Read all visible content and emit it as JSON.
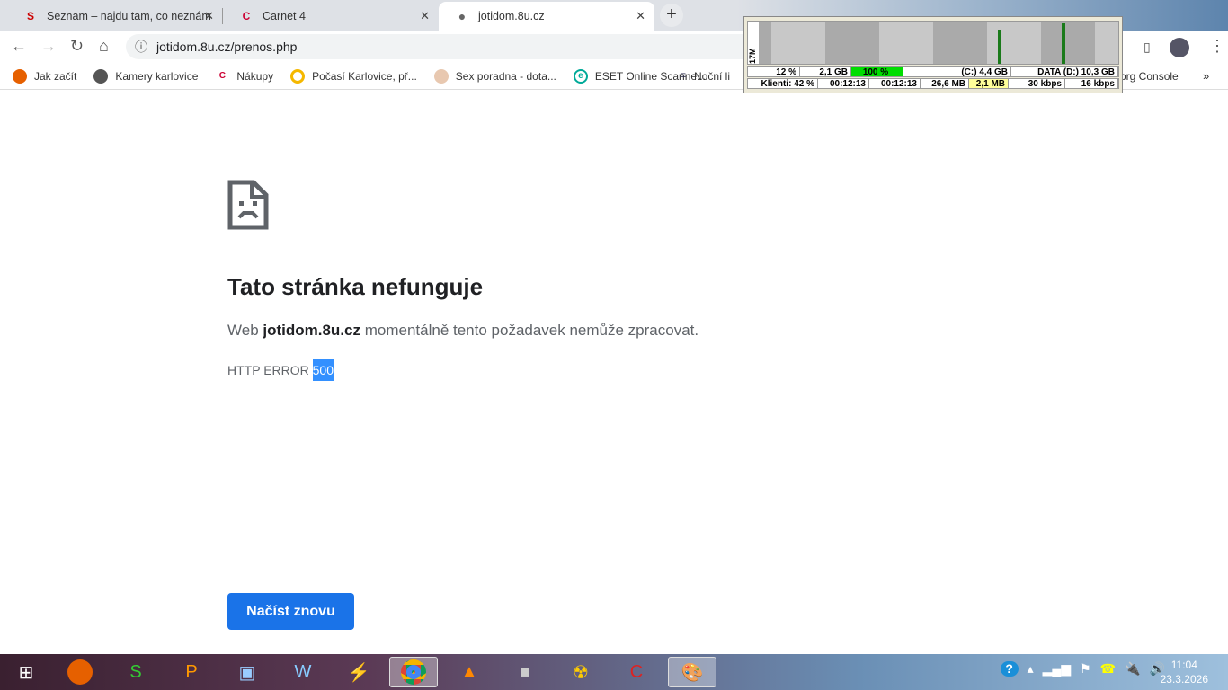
{
  "tabs": [
    {
      "label": "Seznam – najdu tam, co neznám",
      "icon": "S"
    },
    {
      "label": "Carnet 4",
      "icon": "C"
    },
    {
      "label": "jotidom.8u.cz",
      "icon": "globe"
    }
  ],
  "address": "jotidom.8u.cz/prenos.php",
  "bookmarks": [
    "Jak začít",
    "Kamery karlovice",
    "Nákupy",
    "Počasí Karlovice, př...",
    "Sex poradna - dota...",
    "ESET Online Scanne...",
    "Noční li",
    "org Console"
  ],
  "monitor": {
    "scale": "17M",
    "row1": [
      "12 %",
      "2,1 GB",
      "100 %",
      "(C:) 4,4 GB",
      "DATA (D:) 10,3 GB"
    ],
    "row2": [
      "Klienti:  42 %",
      "00:12:13",
      "00:12:13",
      "26,6 MB",
      "2,1 MB",
      "30 kbps",
      "16 kbps"
    ]
  },
  "error": {
    "title": "Tato stránka nefunguje",
    "desc_pre": "Web ",
    "domain": "jotidom.8u.cz",
    "desc_post": " momentálně tento požadavek nemůže zpracovat.",
    "code_pre": "HTTP ERROR ",
    "code": "500",
    "button": "Načíst znovu"
  },
  "clock": {
    "time": "11:04",
    "date": "23.3.2026"
  }
}
